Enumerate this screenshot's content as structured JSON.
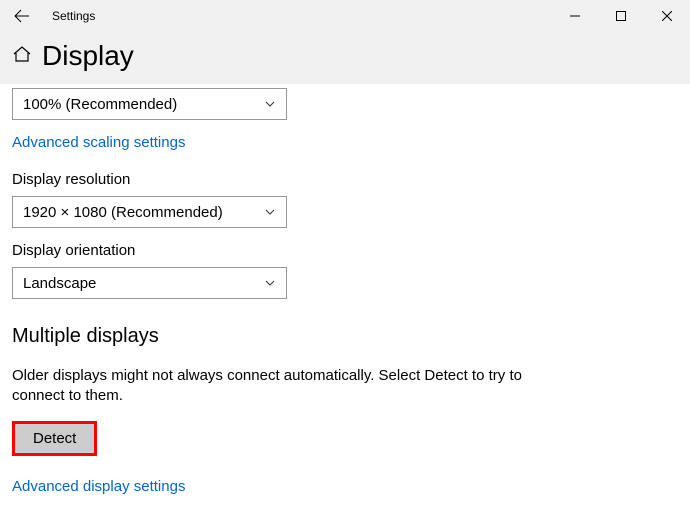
{
  "titlebar": {
    "app_name": "Settings"
  },
  "header": {
    "title": "Display"
  },
  "scale": {
    "selected": "100% (Recommended)",
    "advanced_link": "Advanced scaling settings"
  },
  "resolution": {
    "label": "Display resolution",
    "selected": "1920 × 1080 (Recommended)"
  },
  "orientation": {
    "label": "Display orientation",
    "selected": "Landscape"
  },
  "multiple_displays": {
    "heading": "Multiple displays",
    "help_text": "Older displays might not always connect automatically. Select Detect to try to connect to them.",
    "detect_button": "Detect",
    "advanced_link": "Advanced display settings"
  }
}
